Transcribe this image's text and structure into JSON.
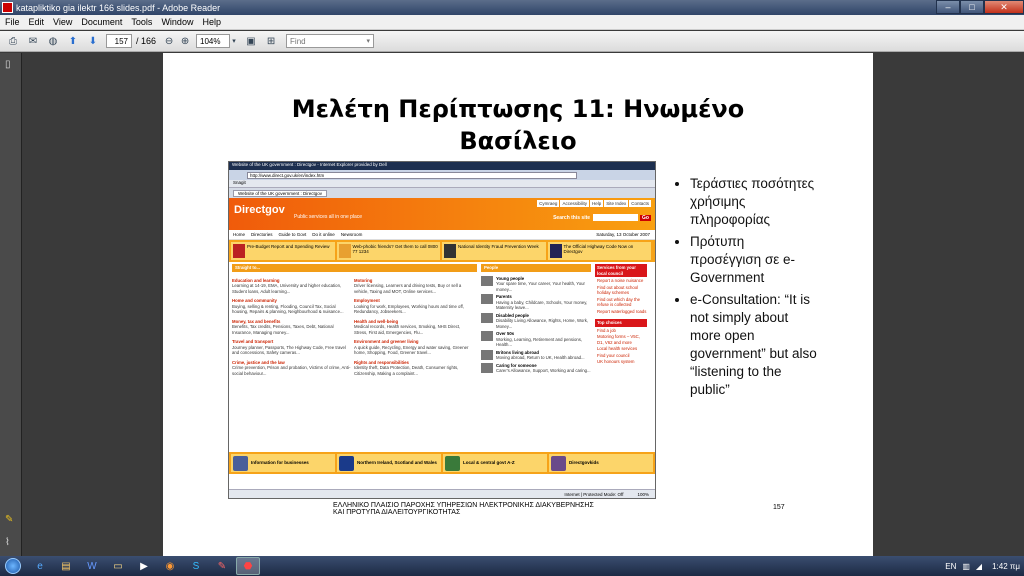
{
  "window": {
    "title": "katapliktiko gia ilektr 166 slides.pdf - Adobe Reader",
    "controls": {
      "minimize": "–",
      "maximize": "□",
      "close": "✕"
    }
  },
  "menu": [
    "File",
    "Edit",
    "View",
    "Document",
    "Tools",
    "Window",
    "Help"
  ],
  "toolbar": {
    "page_current": "157",
    "page_total": "/ 166",
    "zoom": "104%",
    "find_placeholder": "Find"
  },
  "slide": {
    "title_line1": "Μελέτη Περίπτωσης 11: Ηνωμένο",
    "title_line2": "Βασίλειο",
    "bullets": [
      "Τεράστιες ποσότητες χρήσιμης πληροφορίας",
      "Πρότυπη προσέγγιση σε e-Government",
      "e-Consultation: “It is not simply about more open government” but also “listening to the public”"
    ],
    "footer_line1": "ΕΛΛΗΝΙΚΟ ΠΛΑΙΣΙΟ ΠΑΡΟΧΗΣ ΥΠΗΡΕΣΙΩΝ ΗΛΕΚΤΡΟΝΙΚΗΣ ΔΙΑΚΥΒΕΡΝΗΣΗΣ",
    "footer_line2": "ΚΑΙ ΠΡΟΤΥΠΑ ΔΙΑΛΕΙΤΟΥΡΓΙΚΟΤΗΤΑΣ",
    "page_number": "157"
  },
  "screenshot": {
    "ie_title": "Website of the UK government : Directgov - Internet Explorer provided by Dell",
    "url": "http://www.direct.gov.uk/en/index.htm",
    "fav_label": "Snagit",
    "tab_label": "Website of the UK government : Directgov",
    "logo": "Directgov",
    "tagline": "Public services all in one place",
    "top_links": [
      "Cymraeg",
      "Accessibility",
      "Help",
      "Site Index",
      "Contacts"
    ],
    "search_label": "Search this site",
    "search_go": "Go",
    "nav": [
      "Home",
      "Directories",
      "Guide to Govt",
      "Do it online",
      "Newsroom"
    ],
    "date": "Saturday, 13 October 2007",
    "promos": [
      "Pre-Budget Report and Spending Review",
      "Web-phobic friends? Get them to call 0800 77 1234",
      "National Identity Fraud Prevention Week",
      "The Official Highway Code Now on Directgov"
    ],
    "straight_header": "Straight to...",
    "categories": [
      {
        "name": "Education and learning",
        "desc": "Learning at 14-19, EMA, University and higher education, Student loans, Adult learning..."
      },
      {
        "name": "Motoring",
        "desc": "Driver licensing, Learners and driving tests, Buy or sell a vehicle, Taxing and MOT, Online services..."
      },
      {
        "name": "Home and community",
        "desc": "Buying, selling & renting, Flooding, Council Tax, Social housing, Repairs & planning, Neighbourhood & nuisance..."
      },
      {
        "name": "Employment",
        "desc": "Looking for work, Employees, Working hours and time off, Redundancy, Jobseekers..."
      },
      {
        "name": "Money, tax and benefits",
        "desc": "Benefits, Tax credits, Pensions, Taxes, Debt, National Insurance, Managing money..."
      },
      {
        "name": "Health and well-being",
        "desc": "Medical records, Health services, Smoking, NHS Direct, Stress, First aid, Emergencies, Flu..."
      },
      {
        "name": "Travel and transport",
        "desc": "Journey planner, Passports, The Highway Code, Free travel and concessions, Safety cameras..."
      },
      {
        "name": "Environment and greener living",
        "desc": "A quick guide, Recycling, Energy and water saving, Greener home, Shopping, Food, Greener travel..."
      },
      {
        "name": "Crime, justice and the law",
        "desc": "Crime prevention, Prison and probation, Victims of crime, Anti-social behaviour..."
      },
      {
        "name": "Rights and responsibilities",
        "desc": "Identity theft, Data Protection, Death, Consumer rights, Citizenship, Making a complaint..."
      }
    ],
    "people_header": "People",
    "people": [
      {
        "name": "Young people",
        "desc": "Your spare time, Your career, Your health, Your money..."
      },
      {
        "name": "Parents",
        "desc": "Having a baby, Childcare, Schools, Your money, Maternity leave..."
      },
      {
        "name": "Disabled people",
        "desc": "Disability Living Allowance, Rights, Home, Work, Money..."
      },
      {
        "name": "Over 50s",
        "desc": "Working, Learning, Retirement and pensions, Health..."
      },
      {
        "name": "Britons living abroad",
        "desc": "Moving abroad, Return to UK, Health abroad..."
      },
      {
        "name": "Caring for someone",
        "desc": "Carer's Allowance, Support, Working and caring..."
      }
    ],
    "council_header": "Services from your local council",
    "council_items": [
      "Report a noise nuisance",
      "Find out about school holiday schemes",
      "Find out which day the refuse is collected",
      "Report waterlogged roads"
    ],
    "top_choices_header": "Top choices",
    "top_choices": [
      "Find a job",
      "Motoring forms – V5C, D1, V62 and more",
      "Local health services",
      "Find your council",
      "UK honours system"
    ],
    "bottom_promos": [
      "Information for businesses",
      "Northern Ireland, Scotland and Wales",
      "Local & central govt A-Z",
      "Directgovkids"
    ],
    "status_zone": "Internet | Protected Mode: Off",
    "status_zoom": "100%"
  },
  "taskbar": {
    "language": "EN",
    "clock": "1:42 πμ"
  }
}
